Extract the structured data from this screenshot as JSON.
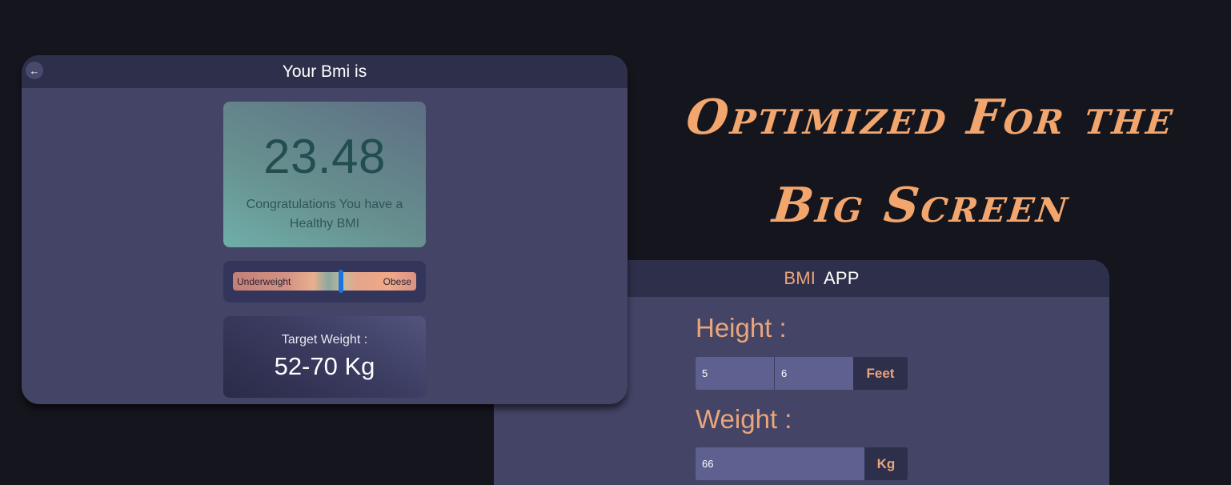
{
  "headline": {
    "line1": "Optimized For the",
    "line2": "Big Screen"
  },
  "input_screen": {
    "brand_accent": "BMI",
    "brand_main": "APP",
    "height_label": "Height :",
    "height_feet_value": "5",
    "height_inches_value": "6",
    "height_unit": "Feet",
    "weight_label": "Weight :",
    "weight_value": "66",
    "weight_unit": "Kg"
  },
  "result_screen": {
    "title": "Your Bmi is",
    "back_icon": "arrow-left-icon",
    "bmi_value": "23.48",
    "message": "Congratulations You have a Healthy BMI",
    "scale": {
      "left_label": "Underweight",
      "right_label": "Obese",
      "marker_fraction": 0.59
    },
    "target_label": "Target Weight :",
    "target_value": "52-70 Kg"
  },
  "colors": {
    "background": "#15151d",
    "panel": "#434466",
    "header": "#2e2f4b",
    "accent": "#eba57a",
    "bmi_text": "#234e50",
    "marker": "#1a74e0"
  }
}
